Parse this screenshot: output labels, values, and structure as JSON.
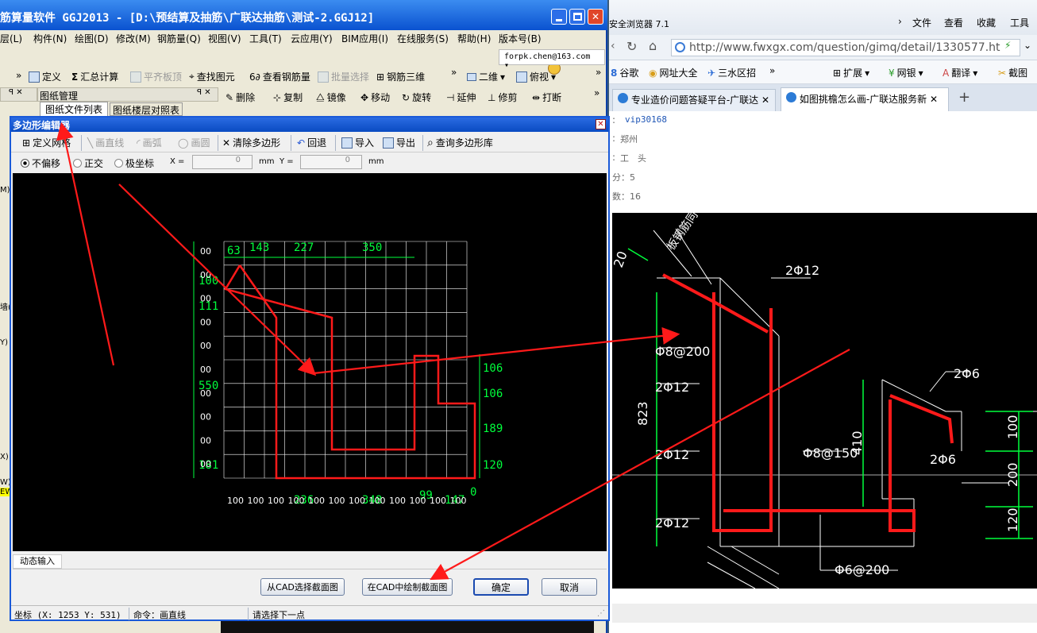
{
  "main_app": {
    "title": "筋算量软件 GGJ2013 - [D:\\预结算及抽筋\\广联达抽筋\\测试-2.GGJ12]",
    "menu": [
      "层(L)",
      "构件(N)",
      "绘图(D)",
      "修改(M)",
      "钢筋量(Q)",
      "视图(V)",
      "工具(T)",
      "云应用(Y)",
      "BIM应用(I)",
      "在线服务(S)",
      "帮助(H)",
      "版本号(B)"
    ],
    "account": "forpk.chen@163.com",
    "toolbar1": {
      "define": "定义",
      "sum": "汇总计算",
      "flat": "平齐板顶",
      "find": "查找图元",
      "view_rebar": "查看钢筋量",
      "batch": "批量选择",
      "rebar3d": "钢筋三维",
      "view2d": "二维",
      "top_view": "俯视"
    },
    "toolbar2": {
      "delete": "删除",
      "copy": "复制",
      "mirror": "镜像",
      "move": "移动",
      "rotate": "旋转",
      "extend": "延伸",
      "trim": "修剪",
      "break": "打断"
    },
    "drawing_panel": {
      "title": "图纸管理",
      "tab_files": "图纸文件列表",
      "tab_floor": "图纸楼层对照表"
    },
    "left_chars": [
      "M)",
      "墙(",
      "Y)",
      "X)",
      "W)",
      "EW"
    ]
  },
  "dialog": {
    "title": "多边形编辑器",
    "toolbar": {
      "define_grid": "定义网格",
      "draw_line": "画直线",
      "draw_arc": "画弧",
      "draw_circle": "画圆",
      "clear": "清除多边形",
      "undo": "回退",
      "import": "导入",
      "export": "导出",
      "query_lib": "查询多边形库"
    },
    "options": {
      "no_offset": "不偏移",
      "ortho": "正交",
      "polar": "极坐标",
      "x_label": "X =",
      "x_value": "0",
      "y_label": "Y =",
      "y_value": "0",
      "unit": "mm"
    },
    "grid": {
      "top_dims": [
        "63",
        "143",
        "227",
        "350"
      ],
      "left_ticks": [
        "00",
        "00",
        "00",
        "00",
        "00",
        "00",
        "00",
        "00",
        "00",
        "00"
      ],
      "left_dims": [
        "100",
        "111",
        "550",
        "181"
      ],
      "right_dims": [
        "106",
        "106",
        "189",
        "120"
      ],
      "bottom_ticks": [
        "100",
        "100",
        "100",
        "100",
        "100",
        "100",
        "100",
        "100",
        "100",
        "100",
        "100",
        "100"
      ],
      "bottom_dims": [
        "236",
        "348",
        "99",
        "147",
        "0"
      ]
    },
    "dynamic_input": "动态输入",
    "btn_cad_select": "从CAD选择截面图",
    "btn_cad_draw": "在CAD中绘制截面图",
    "btn_ok": "确定",
    "btn_cancel": "取消",
    "status_coord": "坐标 (X: 1253 Y: 531)",
    "status_cmd": "命令：画直线",
    "status_prompt": "请选择下一点"
  },
  "browser": {
    "title": "安全浏览器 7.1",
    "menu": [
      "文件",
      "查看",
      "收藏",
      "工具"
    ],
    "url": "http://www.fwxgx.com/question/gimq/detail/1330577.ht",
    "bookmarks": [
      "谷歌",
      "网址大全",
      "三水区招",
      "扩展",
      "网银",
      "翻译",
      "截图"
    ],
    "tabs": [
      "专业造价问题答疑平台-广联达",
      "如图挑檐怎么画-广联达服务新"
    ],
    "user": {
      "name": "vip30168",
      "city": "郑州",
      "role": "工　头",
      "points": "分：5",
      "answers": "数：16"
    },
    "cad_labels": {
      "d1": "2Φ12",
      "d2": "Φ8@200",
      "d3": "2Φ12",
      "d4": "2Φ12",
      "d5": "2Φ12",
      "d6": "Φ8@150",
      "d7": "Φ6@200",
      "d8": "2Φ6",
      "d9": "2Φ6",
      "dim823": "823",
      "dim410": "410",
      "dim100": "100",
      "dim200": "200",
      "dim120": "120",
      "dim20": "20",
      "tilt": "板钢筋同"
    }
  },
  "colors": {
    "title_bar": "#0a58d8",
    "red_annot": "#ff1a1a",
    "cad_green": "#00ff3c"
  }
}
